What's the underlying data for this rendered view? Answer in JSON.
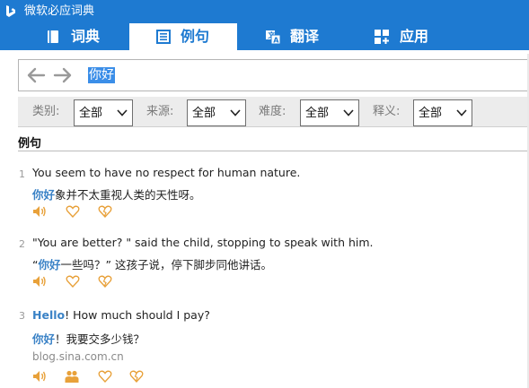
{
  "window": {
    "title": "微软必应词典"
  },
  "tabs": [
    {
      "label": "词典",
      "icon": "book-icon"
    },
    {
      "label": "例句",
      "icon": "list-icon",
      "active": true
    },
    {
      "label": "翻译",
      "icon": "translate-icon"
    },
    {
      "label": "应用",
      "icon": "apps-icon"
    }
  ],
  "search": {
    "query": "你好"
  },
  "filters": [
    {
      "label": "类别:",
      "value": "全部"
    },
    {
      "label": "来源:",
      "value": "全部"
    },
    {
      "label": "难度:",
      "value": "全部"
    },
    {
      "label": "释义:",
      "value": "全部"
    }
  ],
  "section": {
    "title": "例句"
  },
  "examples": [
    {
      "num": "1",
      "en_pre": "",
      "en_hl": "",
      "en_post": "You seem to have no respect for human nature.",
      "zh_pre": "",
      "zh_hl": "你好",
      "zh_post": "象并不太重视人类的天性呀。",
      "source": "",
      "actions": [
        "speaker-icon",
        "heart-icon",
        "broken-heart-icon"
      ]
    },
    {
      "num": "2",
      "en_pre": "",
      "en_hl": "",
      "en_post": "\"You are better? \" said the child, stopping to speak with him.",
      "zh_pre": "“",
      "zh_hl": "你好",
      "zh_post": "一些吗？” 这孩子说，停下脚步同他讲话。",
      "source": "",
      "actions": [
        "speaker-icon",
        "heart-icon",
        "broken-heart-icon"
      ]
    },
    {
      "num": "3",
      "en_pre": "",
      "en_hl": "Hello",
      "en_post": "! How much should I pay?",
      "zh_pre": "",
      "zh_hl": "你好",
      "zh_post": "！我要交多少钱？",
      "source": "blog.sina.com.cn",
      "actions": [
        "speaker-icon",
        "users-icon",
        "heart-icon",
        "broken-heart-icon"
      ]
    }
  ],
  "colors": {
    "brand": "#1e7ad1",
    "highlight": "#3a82c6",
    "icon_orange": "#e8a13a"
  }
}
